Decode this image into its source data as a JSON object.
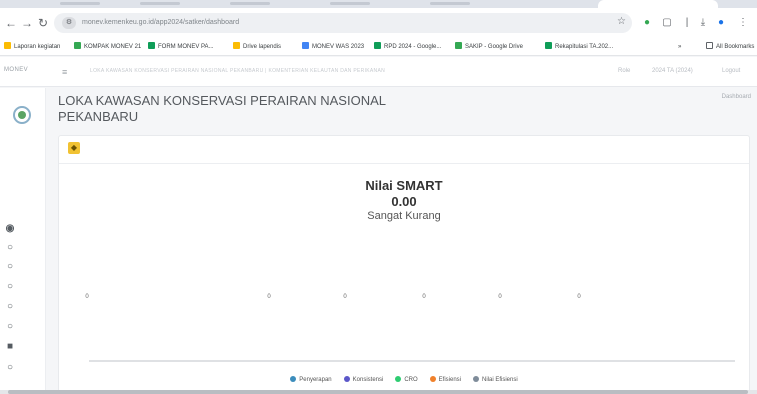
{
  "browser": {
    "url": "monev.kemenkeu.go.id/app2024/satker/dashboard",
    "bookmarks": [
      "Laporan kegiatan",
      "KOMPAK MONEV 21",
      "FORM MONEV PA...",
      "Drive lapendis",
      "MONEV WAS 2023",
      "RPD 2024 - Google...",
      "SAKIP - Google Drive",
      "Rekapitulasi TA.202...",
      "All Bookmarks"
    ]
  },
  "app": {
    "brand": "MONEV",
    "breadcrumb": "LOKA KAWASAN KONSERVASI PERAIRAN NASIONAL PEKANBARU | KOMENTERIAN KELAUTAN DAN PERIKANAN",
    "right_links": [
      "Role",
      "2024 TA (2024)",
      "Logout"
    ]
  },
  "page": {
    "title": "LOKA KAWASAN KONSERVASI PERAIRAN NASIONAL PEKANBARU",
    "dashboard_link": "Dashboard"
  },
  "card": {
    "smart_title": "Nilai SMART",
    "smart_value": "0.00",
    "smart_category": "Sangat Kurang"
  },
  "chart_data": {
    "type": "scatter",
    "categories": [
      "",
      "",
      "",
      "",
      "",
      ""
    ],
    "series": [
      {
        "name": "Penyerapan",
        "values": [
          0,
          0,
          0,
          0,
          0,
          0
        ]
      }
    ],
    "point_labels": [
      "0",
      "0",
      "0",
      "0",
      "0",
      "0"
    ],
    "legend": [
      "Penyerapan",
      "Konsistensi",
      "CRO",
      "Efisiensi",
      "Nilai Efisiensi"
    ],
    "legend_colors": [
      "#3c8dbc",
      "#5b57c9",
      "#2ecc71",
      "#f0812b",
      "#7f8c9a"
    ],
    "legend_position": "bottom"
  }
}
